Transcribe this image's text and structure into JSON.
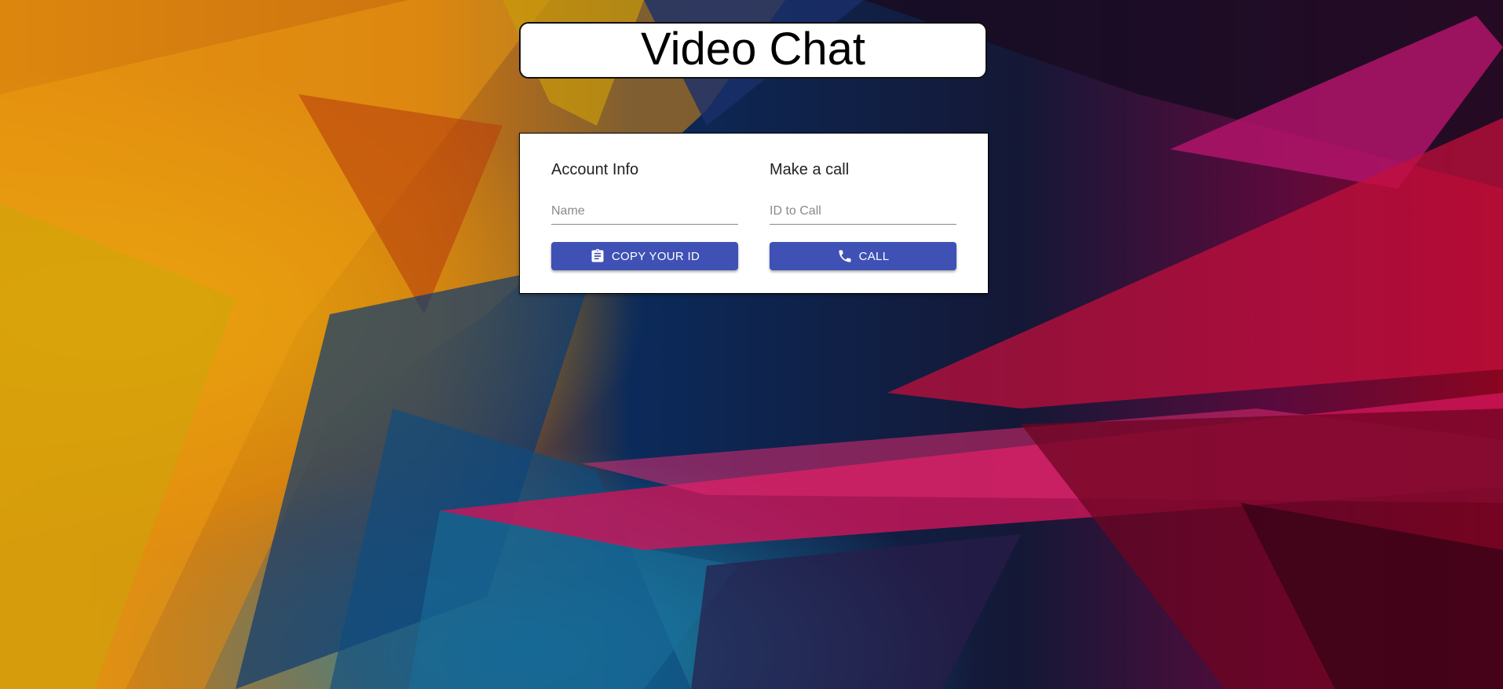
{
  "header": {
    "title": "Video Chat"
  },
  "account": {
    "heading": "Account Info",
    "name_placeholder": "Name",
    "copy_button_label": "COPY YOUR ID",
    "copy_button_icon": "clipboard-icon"
  },
  "call": {
    "heading": "Make a call",
    "id_placeholder": "ID to Call",
    "call_button_label": "CALL",
    "call_button_icon": "phone-icon"
  },
  "colors": {
    "button": "#3f51b5",
    "card": "#ffffff"
  }
}
